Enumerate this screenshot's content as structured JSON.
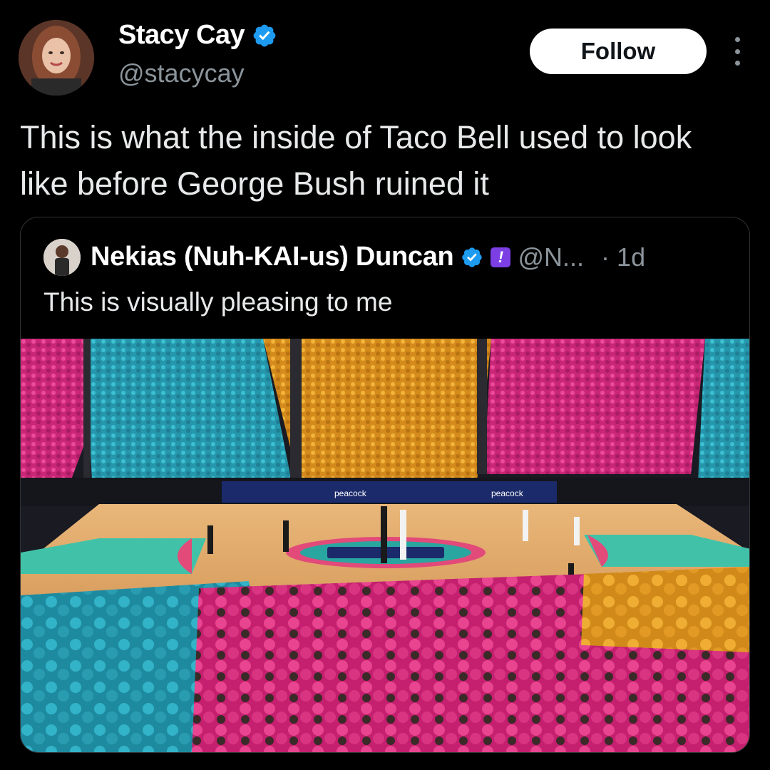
{
  "tweet": {
    "author": {
      "name": "Stacy Cay",
      "handle": "@stacycay",
      "verified": true
    },
    "follow_label": "Follow",
    "more_icon": "more-vertical-icon",
    "text": "This is what the inside of Taco Bell used to look like before George Bush ruined it"
  },
  "quoted_tweet": {
    "author": {
      "name": "Nekias (Nuh-KAI-us) Duncan",
      "handle": "@N...",
      "verified": true,
      "badge_icon": "exclamation-badge-icon",
      "badge_glyph": "!"
    },
    "separator": "·",
    "timestamp": "1d",
    "text": "This is visually pleasing to me",
    "media": {
      "description_icon": "arena-photo",
      "banner_texts": [
        "peacock",
        "peacock"
      ]
    }
  },
  "colors": {
    "background": "#000000",
    "verified_blue": "#1d9bf0",
    "badge_purple": "#7b3fe4",
    "muted_text": "#8b949b",
    "crowd_teal": "#2aa6b8",
    "crowd_gold": "#e8a32a",
    "crowd_pink": "#e0338a"
  }
}
